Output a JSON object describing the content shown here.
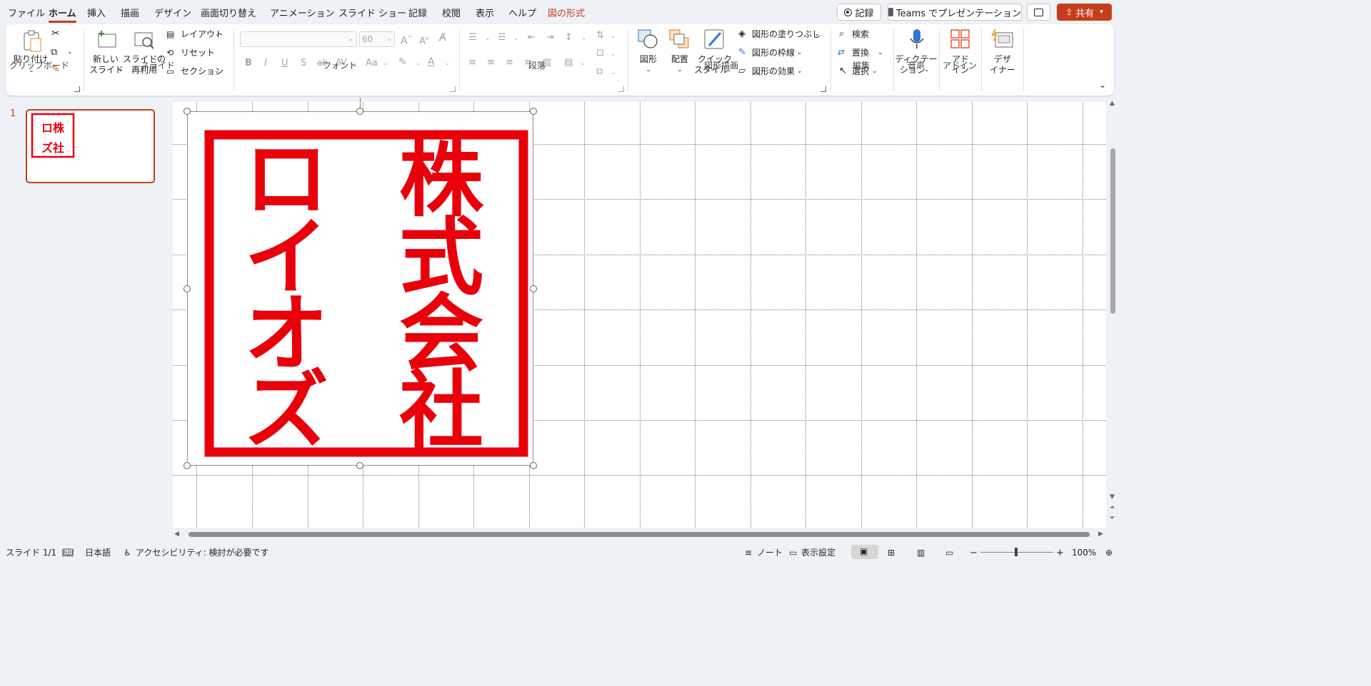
{
  "menu": {
    "tabs": [
      "ファイル",
      "ホーム",
      "挿入",
      "描画",
      "デザイン",
      "画面切り替え",
      "アニメーション",
      "スライド ショー",
      "記録",
      "校閲",
      "表示",
      "ヘルプ",
      "図の形式"
    ],
    "active_tab": "ホーム",
    "contextual_tab": "図の形式",
    "record_button": "記録",
    "teams_button": "Teams でプレゼンテーション",
    "share_button": "共有"
  },
  "ribbon": {
    "clipboard": {
      "paste": "貼り付け",
      "group": "クリップボード"
    },
    "slides": {
      "new_slide_line1": "新しい",
      "new_slide_line2": "スライド",
      "reuse_line1": "スライドの",
      "reuse_line2": "再利用",
      "layout": "レイアウト",
      "reset": "リセット",
      "section": "セクション",
      "group": "スライド"
    },
    "font": {
      "font_size": "60",
      "group": "フォント",
      "bold": "B",
      "italic": "I",
      "underline": "U",
      "shadow": "S",
      "strike": "ab",
      "spacing": "AV",
      "case": "Aa"
    },
    "paragraph": {
      "group": "段落"
    },
    "drawing": {
      "shapes": "図形",
      "arrange": "配置",
      "quick_style_line1": "クイック",
      "quick_style_line2": "スタイル",
      "fill": "図形の塗りつぶし",
      "outline": "図形の枠線",
      "effects": "図形の効果",
      "group": "図形描画"
    },
    "editing": {
      "find": "検索",
      "replace": "置換",
      "select": "選択",
      "group": "編集"
    },
    "voice": {
      "dictate_line1": "ディクテー",
      "dictate_line2": "ション",
      "group": "音声"
    },
    "addins": {
      "label_line1": "アド",
      "label_line2": "イン",
      "group": "アドイン"
    },
    "designer": {
      "label_line1": "デザ",
      "label_line2": "イナー"
    }
  },
  "thumbnails": {
    "slide_number": "1"
  },
  "slide": {
    "seal_text_right": "株式会社",
    "seal_text_left": "ロイオズ",
    "seal_color": "#e8000b"
  },
  "status": {
    "slide_indicator": "スライド 1/1",
    "language": "日本語",
    "accessibility": "アクセシビリティ: 検討が必要です",
    "notes": "ノート",
    "display_settings": "表示設定",
    "zoom": "100%"
  },
  "colors": {
    "accent": "#c43e1c",
    "ribbon_bg": "#ffffff",
    "app_bg": "#eef1f5"
  }
}
